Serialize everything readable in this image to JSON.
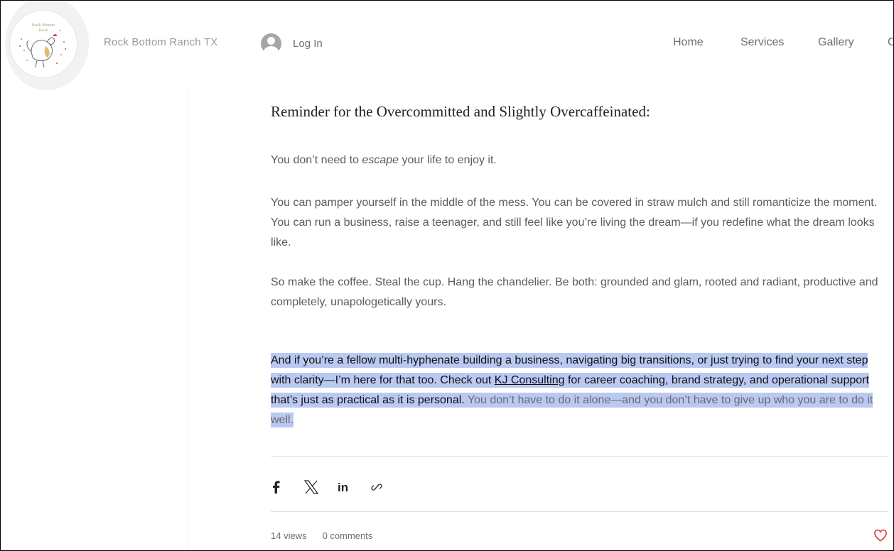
{
  "header": {
    "site_name": "Rock Bottom Ranch TX",
    "login_label": "Log In",
    "nav": [
      "Home",
      "Services",
      "Gallery",
      "C"
    ]
  },
  "post": {
    "title": "Reminder for the Overcommitted and Slightly Overcaffeinated:",
    "p1": {
      "before": "You don’t need to ",
      "em": "escape",
      "after": " your life to enjoy it."
    },
    "p2": "You can pamper yourself in the middle of the mess. You can be covered in straw mulch and still romanticize the moment. You can run a business, raise a teenager, and still feel like you’re living the dream—if you redefine what the dream looks like.",
    "p3": "So make the coffee. Steal the cup. Hang the chandelier. Be both: grounded and glam, rooted and radiant, productive and completely, unapologetically yours.",
    "p4": {
      "before": "And if you’re a fellow multi-hyphenate building a business, navigating big transitions, or just trying to find your next step with clarity—I’m here for that too. Check out ",
      "link": "KJ Consulting",
      "after": " for career coaching, brand strategy, and operational support that’s just as practical as it is personal.",
      "muted": " You don’t have to do it alone—and you don’t have to give up who you are to do it well."
    }
  },
  "share": {
    "icons": [
      "facebook-icon",
      "x-icon",
      "linkedin-icon",
      "link-icon"
    ]
  },
  "stats": {
    "views": "14 views",
    "comments": "0 comments"
  },
  "colors": {
    "highlight": "#b9c9f2",
    "heart": "#e04545",
    "logo_text": "#b0a070"
  }
}
